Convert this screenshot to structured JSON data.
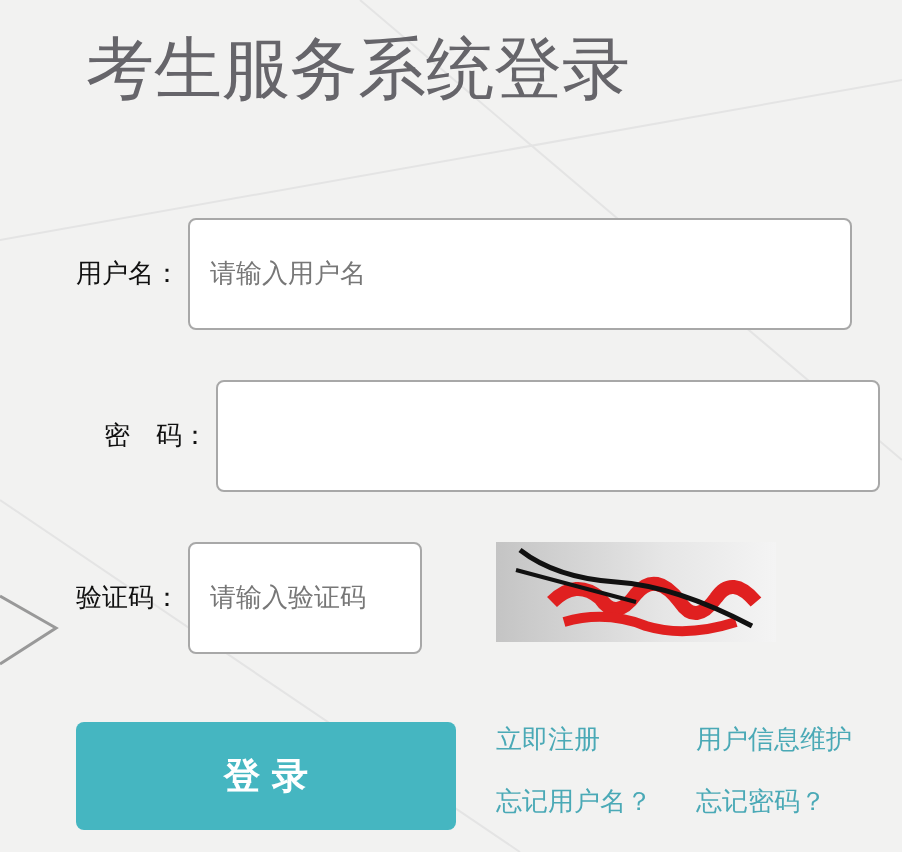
{
  "title": "考生服务系统登录",
  "fields": [
    {
      "kind": "text",
      "label": "用户名：",
      "placeholder": "请输入用户名"
    },
    {
      "kind": "password",
      "label": "密　码："
    },
    {
      "kind": "captcha",
      "label": "验证码：",
      "placeholder": "请输入验证码"
    }
  ],
  "login_button": "登 录",
  "links": [
    {
      "label": "立即注册"
    },
    {
      "label": "用户信息维护"
    },
    {
      "label": "忘记用户名？"
    },
    {
      "label": "忘记密码？"
    }
  ]
}
